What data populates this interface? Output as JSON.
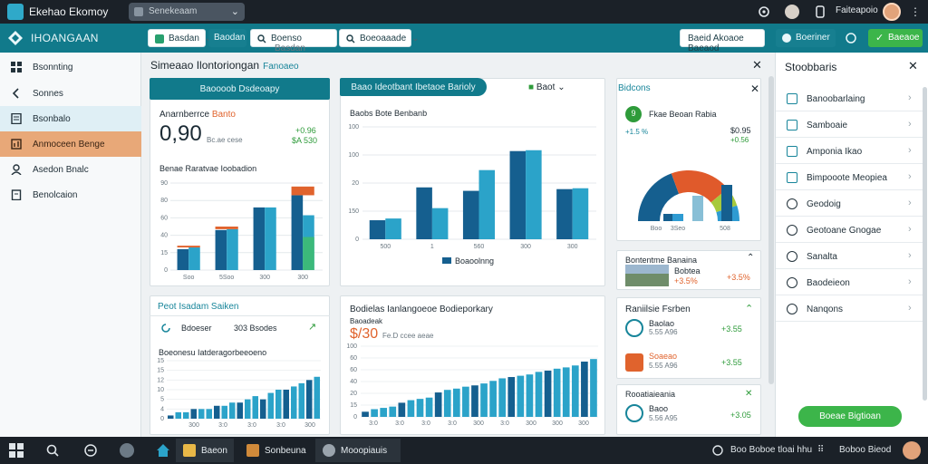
{
  "titlebar": {
    "app_title": "Ekehao Ekomoy",
    "search_placeholder": "Senekeaam",
    "user_name": "Faiteapoio"
  },
  "toolbar": {
    "title": "IHOANGAAN",
    "buttons": [
      "Basdan",
      "Boenso",
      "Basdan",
      "Boeoaaade"
    ],
    "tab": "Baodan",
    "right_button": "Baeid Akoaoe Baeaod",
    "status": "Boeriner",
    "green_button": "Baeaoe"
  },
  "sidebar": {
    "items": [
      "Bsonnting",
      "Sonnes",
      "Bsonbalo",
      "Anmoceen Benge",
      "Asedon Bnalc",
      "Benolcaion"
    ]
  },
  "main": {
    "title": "Simeaao Ilontoriongan",
    "subtitle": "Fanoaeo"
  },
  "card1": {
    "tab": "Baoooob Dsdeoapy",
    "label_a": "Anarnberrce",
    "label_b": "Banto",
    "big_value": "0,90",
    "big_sub": "Bc.ae cese",
    "delta_top": "+0.96",
    "delta_bottom": "$A 530",
    "chart_title": "Benae Raratvae Ioobadion",
    "chart_data": {
      "type": "bar",
      "categories": [
        "Soo",
        "5Soo",
        "300",
        "300"
      ],
      "ylim": [
        0,
        100
      ],
      "yticks": [
        0,
        15,
        40,
        60,
        80,
        90
      ],
      "series": [
        {
          "values": [
            24,
            46,
            72,
            86
          ]
        },
        {
          "values": [
            26,
            47,
            72,
            63
          ]
        },
        {
          "values": [
            2,
            3,
            0,
            10
          ]
        },
        {
          "values": [
            0,
            0,
            0,
            38
          ]
        }
      ],
      "colors": [
        "#155f8f",
        "#2ba3c9",
        "#e0632d",
        "#3cb97a"
      ]
    }
  },
  "card2": {
    "tab": "Baao Ideotbant Ibetaoe Barioly",
    "dropdown": "Baot",
    "title": "Baobs Bote Benbanb",
    "legend": "Boaoolnng",
    "chart_data": {
      "type": "bar",
      "categories": [
        "500",
        "1",
        "560",
        "300",
        "300"
      ],
      "yticks": [
        0,
        150,
        20,
        100,
        100
      ],
      "ylim": [
        0,
        130
      ],
      "series": [
        {
          "values": [
            22,
            60,
            56,
            102,
            58
          ]
        },
        {
          "values": [
            24,
            36,
            80,
            103,
            59
          ]
        }
      ],
      "colors": [
        "#155f8f",
        "#2ba3c9"
      ]
    }
  },
  "card3": {
    "title": "Bidcons",
    "item_title": "Fkae Beoan Rabia",
    "item_sub_a": "+1.5 %",
    "item_value": "$0.95",
    "item_delta": "+0.56",
    "chart_data": {
      "type": "pie",
      "labels": [
        "Boo",
        "3Seo",
        "508"
      ],
      "values": [
        38,
        17,
        45
      ],
      "colors": [
        "#155f8f",
        "#e05a2b",
        "#2e9bd2",
        "#a7c93c",
        "#88bfd6"
      ]
    }
  },
  "card4": {
    "title": "Bontentme Banaina",
    "row_a": "Bobtea",
    "row_a_value": "+3.5%",
    "row_a_delta": "+3.5%"
  },
  "card5": {
    "tab": "Peot Isadam Saiken",
    "row_label": "Bdoeser",
    "row_value": "303 Bsodes",
    "chart_title": "Boeonesu Iatderagorbeeoeno",
    "chart_data": {
      "type": "bar",
      "categories": [
        "300",
        "3:0",
        "3:0",
        "3:0",
        "300"
      ],
      "yticks": [
        0,
        4,
        5,
        10,
        12,
        15,
        15
      ],
      "ylim": [
        0,
        18
      ],
      "values": [
        1,
        2,
        2,
        3,
        3,
        3,
        4,
        4,
        5,
        5,
        6,
        7,
        6,
        8,
        9,
        9,
        10,
        11,
        12,
        13
      ]
    }
  },
  "card6": {
    "title": "Bodielas Ianlangoeoe Bodieporkary",
    "subtitle": "Baoadeak",
    "value": "$/30",
    "value_sub": "Fe.D ccee aeae",
    "chart_data": {
      "type": "bar",
      "categories": [
        "3:0",
        "3:0",
        "3:0",
        "3:0",
        "300",
        "3:0",
        "300",
        "300",
        "300"
      ],
      "yticks": [
        0,
        15,
        20,
        40,
        60,
        60,
        100
      ],
      "ylim": [
        0,
        110
      ],
      "values": [
        8,
        12,
        14,
        16,
        22,
        26,
        28,
        30,
        38,
        42,
        44,
        47,
        49,
        52,
        56,
        60,
        62,
        64,
        66,
        70,
        72,
        75,
        77,
        80,
        86,
        90
      ]
    }
  },
  "card7": {
    "title": "Raniilsie Fsrben",
    "rows": [
      {
        "name": "Baolao",
        "sub": "5.55 A96",
        "value": "+3.55"
      },
      {
        "name": "Soaeao",
        "sub": "5.55 A96",
        "value": "+3.55"
      },
      {
        "name": "Baanieo",
        "sub": "5.55 A96",
        "value": "+3.35"
      }
    ]
  },
  "card8": {
    "title": "Rooatiaieania",
    "row_name": "Baoo",
    "row_sub": "5.56 A95",
    "row_value": "+3.05"
  },
  "settings": {
    "title": "Stoobbaris",
    "items": [
      "Banoobarlaing",
      "Samboaie",
      "Amponia Ikao",
      "Bimpooote Meopiea",
      "Geodoig",
      "Geotoane Gnogae",
      "Sanalta",
      "Baodeieon",
      "Nanqons"
    ],
    "action": "Boeae Bigtioan"
  },
  "taskbar": {
    "apps": [
      "Baeon",
      "Sonbeuna",
      "Mooopiauis"
    ],
    "tray_a": "Boo Boboe tloai hhu",
    "tray_b": "Boboo Bieod"
  }
}
